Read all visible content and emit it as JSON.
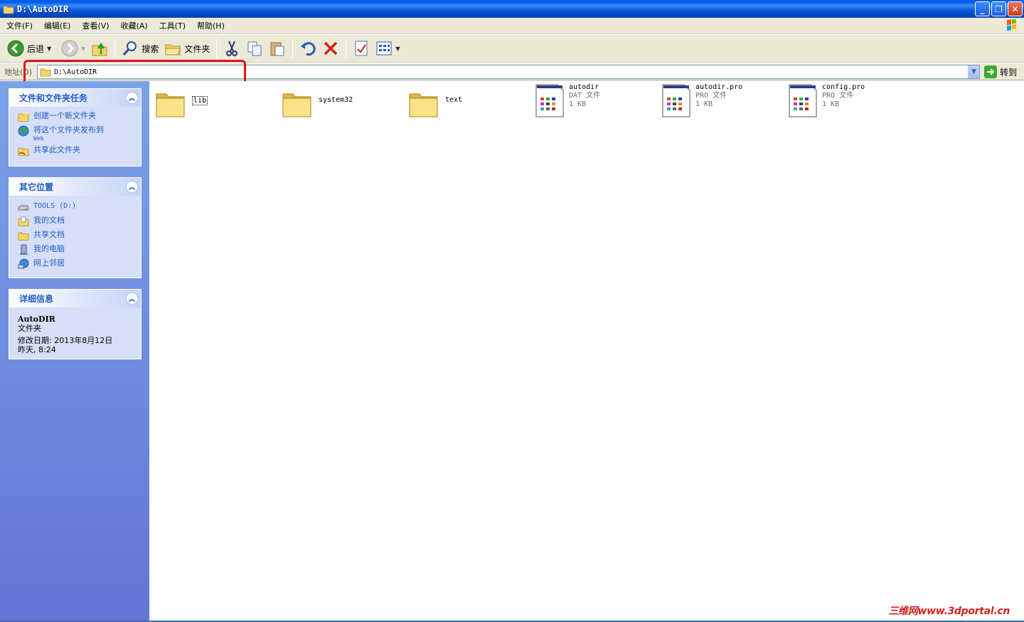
{
  "window": {
    "title": "D:\\AutoDIR"
  },
  "menu": [
    "文件(F)",
    "编辑(E)",
    "查看(V)",
    "收藏(A)",
    "工具(T)",
    "帮助(H)"
  ],
  "toolbar": {
    "back_label": "后退",
    "search_label": "搜索",
    "folders_label": "文件夹"
  },
  "address": {
    "label": "地址(D)",
    "value": "D:\\AutoDIR",
    "go_label": "转到"
  },
  "tasks_panel": {
    "title": "文件和文件夹任务",
    "items": [
      "创建一个新文件夹",
      "将这个文件夹发布到",
      "共享此文件夹"
    ],
    "publish_sub": "Web"
  },
  "places_panel": {
    "title": "其它位置",
    "items": [
      "TOOLS (D:)",
      "我的文档",
      "共享文档",
      "我的电脑",
      "网上邻居"
    ]
  },
  "details_panel": {
    "title": "详细信息",
    "name": "AutoDIR",
    "type": "文件夹",
    "modified_label": "修改日期: 2013年8月12日",
    "modified_time": "昨天, 8:24"
  },
  "files": {
    "folders": [
      {
        "name": "lib"
      },
      {
        "name": "system32"
      },
      {
        "name": "text"
      }
    ],
    "documents": [
      {
        "name": "autodir",
        "type": "DAT 文件",
        "size": "1 KB"
      },
      {
        "name": "autodir.pro",
        "type": "PRO 文件",
        "size": "1 KB"
      },
      {
        "name": "config.pro",
        "type": "PRO 文件",
        "size": "1 KB"
      }
    ]
  },
  "watermark": "三维网www.3dportal.cn",
  "colors": {
    "titlebar": "#0058ee",
    "taskpane_link": "#215dc6",
    "highlight": "#e01414"
  }
}
